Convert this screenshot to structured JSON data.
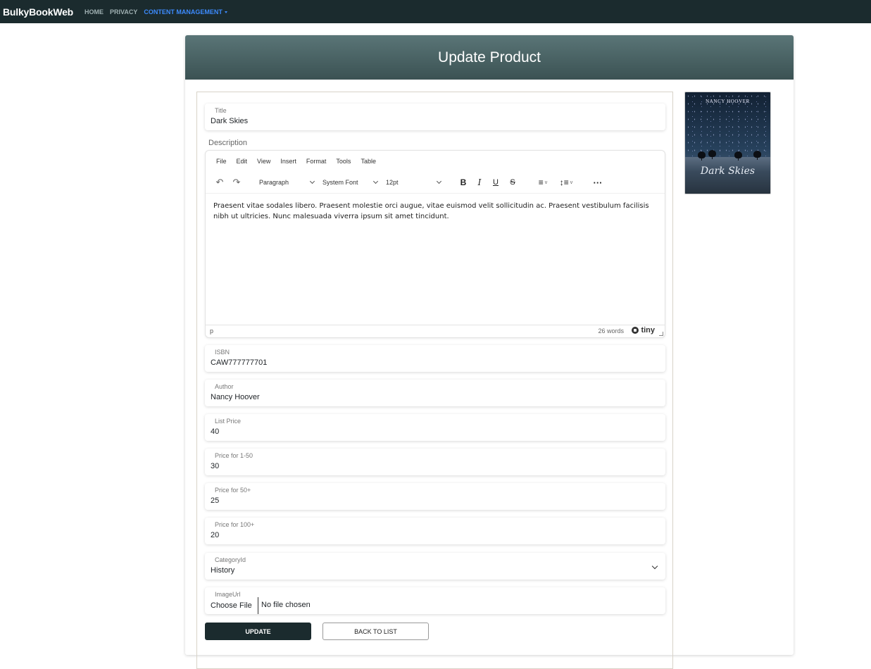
{
  "nav": {
    "brand": "BulkyBookWeb",
    "links": [
      "HOME",
      "PRIVACY",
      "CONTENT MANAGEMENT"
    ]
  },
  "page": {
    "title": "Update Product"
  },
  "form": {
    "title": {
      "label": "Title",
      "value": "Dark Skies"
    },
    "description": {
      "label": "Description",
      "menu": [
        "File",
        "Edit",
        "View",
        "Insert",
        "Format",
        "Tools",
        "Table"
      ],
      "block_format": "Paragraph",
      "font_family": "System Font",
      "font_size": "12pt",
      "content": "Praesent vitae sodales libero. Praesent molestie orci augue, vitae euismod velit sollicitudin ac. Praesent vestibulum facilisis nibh ut ultricies. Nunc malesuada viverra ipsum sit amet tincidunt.",
      "status_path": "p",
      "word_count": "26 words",
      "brand": "tiny"
    },
    "isbn": {
      "label": "ISBN",
      "value": "CAW777777701"
    },
    "author": {
      "label": "Author",
      "value": "Nancy Hoover"
    },
    "list_price": {
      "label": "List Price",
      "value": "40"
    },
    "price_1_50": {
      "label": "Price for 1-50",
      "value": "30"
    },
    "price_50": {
      "label": "Price for 50+",
      "value": "25"
    },
    "price_100": {
      "label": "Price for 100+",
      "value": "20"
    },
    "category": {
      "label": "CategoryId",
      "value": "History"
    },
    "image": {
      "label": "ImageUrl",
      "button": "Choose File",
      "status": "No file chosen"
    },
    "buttons": {
      "update": "UPDATE",
      "back": "BACK TO LIST"
    }
  },
  "cover": {
    "author": "NANCY HOOVER",
    "title": "Dark Skies"
  },
  "colors": {
    "navbar": "#1b2b2e",
    "header": "#4a6466",
    "accent": "#3d8bfd"
  }
}
